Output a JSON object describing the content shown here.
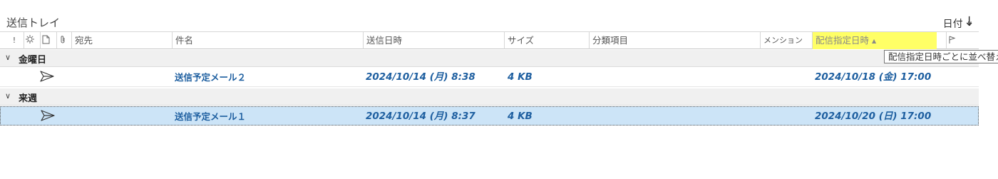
{
  "folder": {
    "title": "送信トレイ"
  },
  "sort": {
    "label": "日付",
    "chevron": "⌄",
    "direction_arrow": "↓"
  },
  "columns": {
    "importance_icon": "!",
    "reminder_icon": "☼",
    "type_icon": "🗋",
    "attachment_icon": "🖇",
    "to": "宛先",
    "subject": "件名",
    "sent": "送信日時",
    "size": "サイズ",
    "category": "分類項目",
    "mention": "メンション",
    "deferred": "配信指定日時",
    "flag_icon": "⚑"
  },
  "groups": [
    {
      "label": "金曜日",
      "items": [
        {
          "subject": "送信予定メール２",
          "sent": "2024/10/14 (月) 8:38",
          "size": "4 KB",
          "deferred": "2024/10/18 (金) 17:00"
        }
      ]
    },
    {
      "label": "来週",
      "items": [
        {
          "subject": "送信予定メール１",
          "sent": "2024/10/14 (月) 8:37",
          "size": "4 KB",
          "deferred": "2024/10/20 (日) 17:00"
        }
      ]
    }
  ],
  "tooltip": "配信指定日時ごとに並べ替え",
  "colors": {
    "accent": "#1e5fa0",
    "highlight": "#ffff66",
    "selected": "#cce4f7"
  }
}
